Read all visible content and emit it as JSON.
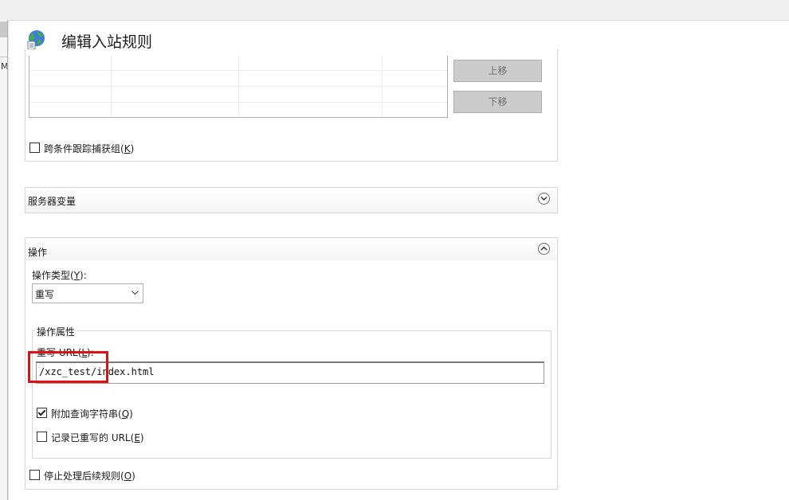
{
  "title": "编辑入站规则",
  "buttons": {
    "move_up": "上移",
    "move_down": "下移"
  },
  "track_capture": {
    "text": "跨条件跟踪捕获组(",
    "key": "K",
    "suffix": ")",
    "checked": false
  },
  "server_vars": {
    "title": "服务器变量",
    "icon": "chevron-down-icon"
  },
  "action": {
    "title": "操作",
    "icon": "chevron-up-icon",
    "type_label": "操作类型(",
    "type_key": "Y",
    "type_suffix": "):",
    "type_value": "重写",
    "props_legend": "操作属性",
    "url_label": "重写 URL(",
    "url_key": "L",
    "url_suffix": "):",
    "url_value": "/xzc_test/index.html",
    "append_query": {
      "text": "附加查询字符串(",
      "key": "Q",
      "suffix": ")",
      "checked": true
    },
    "log_rewritten": {
      "text": "记录已重写的 URL(",
      "key": "E",
      "suffix": ")",
      "checked": false
    }
  },
  "stop_processing": {
    "text": "停止处理后续规则(",
    "key": "O",
    "suffix": ")",
    "checked": false
  },
  "left_letter": "M",
  "colors": {
    "highlight": "#e01010",
    "button_bg": "#cccccc",
    "border": "#d6d6d6"
  }
}
